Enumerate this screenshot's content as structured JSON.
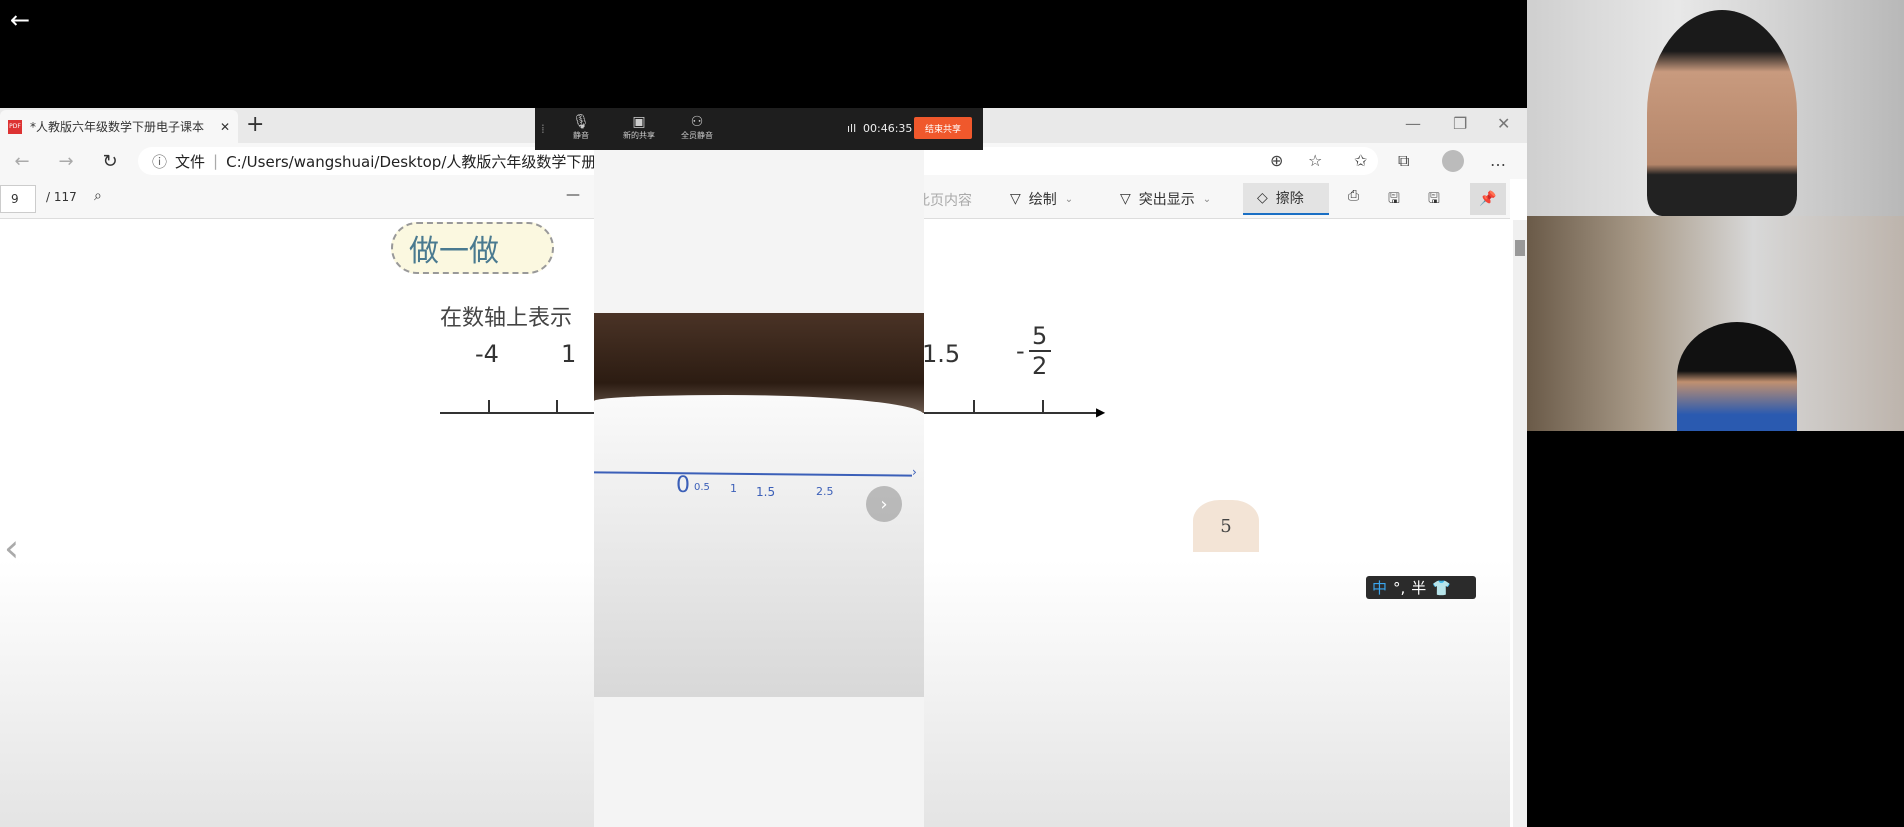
{
  "browser": {
    "tab_title": "*人教版六年级数学下册电子课本",
    "address_prefix": "文件",
    "address": "C:/Users/wangshuai/Desktop/人教版六年级数学下册"
  },
  "pdf_toolbar": {
    "page": "9",
    "total": "/ 117",
    "read_aloud": "朗读此页内容",
    "draw": "绘制",
    "highlight": "突出显示",
    "erase": "擦除"
  },
  "page_content": {
    "badge": "做一做",
    "instruction": "在数轴上表示",
    "numbers": [
      "-4",
      "1",
      "1.5"
    ],
    "fraction": {
      "sign": "-",
      "num": "5",
      "den": "2"
    },
    "page_number": "5"
  },
  "meeting": {
    "mute": "静音",
    "new_share": "新的共享",
    "mute_all": "全员静音",
    "timer": "00:46:35",
    "end_share": "结束共享",
    "accent": "#f0582c"
  },
  "phone_screen": {
    "handwriting": [
      "0",
      "0.5",
      "1",
      "1.5",
      "2.5"
    ]
  },
  "ime": {
    "mode": "中",
    "punct": "°,",
    "width": "半"
  }
}
